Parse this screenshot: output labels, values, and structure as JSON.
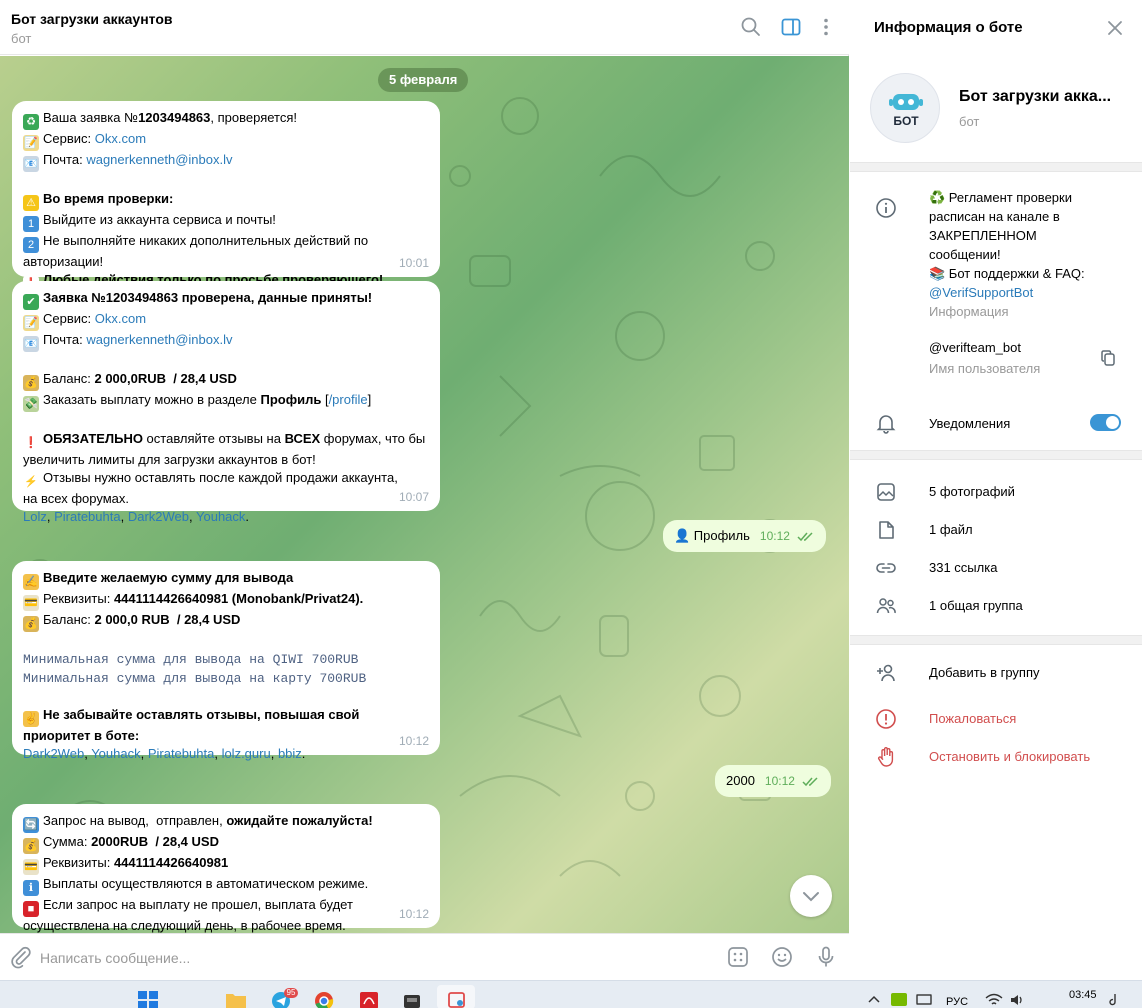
{
  "chat_header": {
    "title": "Бот загрузки аккаунтов",
    "subtitle": "бот"
  },
  "date_separator": "5 февраля",
  "messages": [
    {
      "time": "10:01",
      "lines": [
        {
          "emoji": "♻",
          "emoji_bg": "#3aa857",
          "parts": [
            {
              "t": "Ваша заявка №"
            },
            {
              "t": "1203494863",
              "b": true
            },
            {
              "t": ", проверяется!"
            }
          ]
        },
        {
          "emoji": "📝",
          "emoji_bg": "#f0d98a",
          "parts": [
            {
              "t": "Сервис: "
            },
            {
              "t": "Okx.com",
              "link": true
            }
          ]
        },
        {
          "emoji": "📧",
          "emoji_bg": "#c9d6e3",
          "parts": [
            {
              "t": "Почта: "
            },
            {
              "t": "wagnerkenneth@inbox.lv",
              "link": true
            }
          ]
        },
        {
          "parts": []
        },
        {
          "emoji": "⚠",
          "emoji_bg": "#f5c518",
          "parts": [
            {
              "t": "Во время проверки:",
              "b": true
            }
          ]
        },
        {
          "emoji": "1",
          "emoji_bg": "#3f8fd8",
          "parts": [
            {
              "t": "Выйдите из аккаунта сервиса и почты!"
            }
          ]
        },
        {
          "emoji": "2",
          "emoji_bg": "#3f8fd8",
          "parts": [
            {
              "t": "Не выполняйте никаких дополнительных действий по"
            }
          ]
        },
        {
          "parts": [
            {
              "t": "авторизации!"
            }
          ]
        },
        {
          "emoji": "❗",
          "emoji_bg": "#ffffff",
          "emoji_color": "#d8232a",
          "parts": [
            {
              "t": "Любые действия только по просьбе проверяющего!",
              "b": true
            }
          ]
        }
      ]
    },
    {
      "time": "10:07",
      "lines": [
        {
          "emoji": "✔",
          "emoji_bg": "#3aa857",
          "parts": [
            {
              "t": "Заявка №1203494863 проверена, ",
              "b": true
            },
            {
              "t": "данные приняты!",
              "b": true
            }
          ]
        },
        {
          "emoji": "📝",
          "emoji_bg": "#f0d98a",
          "parts": [
            {
              "t": "Сервис: "
            },
            {
              "t": "Okx.com",
              "link": true
            }
          ]
        },
        {
          "emoji": "📧",
          "emoji_bg": "#c9d6e3",
          "parts": [
            {
              "t": "Почта: "
            },
            {
              "t": "wagnerkenneth@inbox.lv",
              "link": true
            }
          ]
        },
        {
          "parts": []
        },
        {
          "emoji": "💰",
          "emoji_bg": "#d9b45a",
          "parts": [
            {
              "t": "Баланс: "
            },
            {
              "t": "2 000,0RUB  / 28,4 USD",
              "b": true
            }
          ]
        },
        {
          "emoji": "💸",
          "emoji_bg": "#b9d39a",
          "parts": [
            {
              "t": "Заказать выплату можно в разделе "
            },
            {
              "t": "Профиль",
              "b": true
            },
            {
              "t": " ["
            },
            {
              "t": "/profile",
              "link": true
            },
            {
              "t": "]"
            }
          ]
        },
        {
          "parts": []
        },
        {
          "emoji": "❗",
          "emoji_bg": "#ffffff",
          "emoji_color": "#d8232a",
          "parts": [
            {
              "t": "ОБЯЗАТЕЛЬНО",
              "b": true
            },
            {
              "t": " оставляйте отзывы на "
            },
            {
              "t": "ВСЕХ",
              "b": true
            },
            {
              "t": " форумах, что бы"
            }
          ]
        },
        {
          "parts": [
            {
              "t": "увеличить лимиты для загрузки аккаунтов в бот!"
            }
          ]
        },
        {
          "emoji": "⚡",
          "emoji_bg": "#ffffff",
          "emoji_color": "#f2b01e",
          "parts": [
            {
              "t": "Отзывы нужно оставлять после каждой продажи аккаунта,"
            }
          ]
        },
        {
          "parts": [
            {
              "t": "на всех форумах."
            }
          ]
        },
        {
          "parts": [
            {
              "t": "Lolz",
              "link": true
            },
            {
              "t": ", "
            },
            {
              "t": "Piratebuhta",
              "link": true
            },
            {
              "t": ", "
            },
            {
              "t": "Dark2Web",
              "link": true
            },
            {
              "t": ", "
            },
            {
              "t": "Youhack",
              "link": true
            },
            {
              "t": "."
            }
          ]
        }
      ]
    },
    {
      "time": "10:12",
      "lines": [
        {
          "emoji": "✍",
          "emoji_bg": "#f3c14b",
          "parts": [
            {
              "t": "Введите желаемую сумму для вывода",
              "b": true
            }
          ]
        },
        {
          "emoji": "💳",
          "emoji_bg": "#e9e2c8",
          "parts": [
            {
              "t": "Реквизиты: "
            },
            {
              "t": "4441114426640981 (Monobank/Privat24).",
              "b": true
            }
          ]
        },
        {
          "emoji": "💰",
          "emoji_bg": "#d9b45a",
          "parts": [
            {
              "t": "Баланс: "
            },
            {
              "t": "2 000,0 RUB  / 28,4 USD",
              "b": true
            }
          ]
        },
        {
          "parts": []
        },
        {
          "parts": [
            {
              "t": "Минимальная сумма для вывода на QIWI 700RUB",
              "mono": true
            }
          ]
        },
        {
          "parts": [
            {
              "t": "Минимальная сумма для вывода на карту 700RUB",
              "mono": true
            }
          ]
        },
        {
          "parts": []
        },
        {
          "emoji": "✌",
          "emoji_bg": "#f3c14b",
          "parts": [
            {
              "t": "Не забывайте оставлять отзывы, повышая свой",
              "b": true
            }
          ]
        },
        {
          "parts": [
            {
              "t": "приоритет в боте:",
              "b": true
            }
          ]
        },
        {
          "parts": [
            {
              "t": "Dark2Web",
              "link": true
            },
            {
              "t": ", "
            },
            {
              "t": "Youhack",
              "link": true
            },
            {
              "t": ", "
            },
            {
              "t": "Piratebuhta",
              "link": true
            },
            {
              "t": ", "
            },
            {
              "t": "lolz.guru",
              "link": true
            },
            {
              "t": ", "
            },
            {
              "t": "bbiz",
              "link": true
            },
            {
              "t": "."
            }
          ]
        }
      ]
    },
    {
      "time": "10:12",
      "lines": [
        {
          "emoji": "🔄",
          "emoji_bg": "#3f8fd8",
          "parts": [
            {
              "t": "Запрос на вывод,  отправлен, "
            },
            {
              "t": "ожидайте пожалуйста!",
              "b": true
            }
          ]
        },
        {
          "emoji": "💰",
          "emoji_bg": "#d9b45a",
          "parts": [
            {
              "t": "Сумма: "
            },
            {
              "t": "2000RUB  / 28,4 USD",
              "b": true
            }
          ]
        },
        {
          "emoji": "💳",
          "emoji_bg": "#e9e2c8",
          "parts": [
            {
              "t": "Реквизиты: "
            },
            {
              "t": "4441114426640981",
              "b": true
            }
          ]
        },
        {
          "emoji": "ℹ",
          "emoji_bg": "#3f8fd8",
          "parts": [
            {
              "t": "Выплаты осуществляются в автоматическом режиме."
            }
          ]
        },
        {
          "emoji": "■",
          "emoji_bg": "#d8232a",
          "parts": [
            {
              "t": "Если запрос на выплату не прошел, выплата будет"
            }
          ]
        },
        {
          "parts": [
            {
              "t": "осуществлена на следующий день, в рабочее время."
            }
          ]
        }
      ]
    }
  ],
  "outgoing": [
    {
      "text": "👤 Профиль",
      "time": "10:12"
    },
    {
      "text": "2000",
      "time": "10:12"
    }
  ],
  "composer": {
    "placeholder": "Написать сообщение..."
  },
  "side_panel": {
    "title": "Информация о боте",
    "avatar_label": "БОТ",
    "bot_name": "Бот загрузки акка...",
    "bot_type": "бот",
    "about_lines": [
      "♻️ Регламент проверки",
      "расписан на канале в",
      "ЗАКРЕПЛЕННОМ",
      "сообщении!",
      "📚 Бот поддержки & FAQ:"
    ],
    "about_link": "@VerifSupportBot",
    "about_caption": "Информация",
    "username": "@verifteam_bot",
    "username_caption": "Имя пользователя",
    "notifications_label": "Уведомления",
    "notifications_on": true,
    "media": {
      "photos": "5 фотографий",
      "files": "1 файл",
      "links": "331 ссылка",
      "groups": "1 общая группа"
    },
    "actions": {
      "add_group": "Добавить в группу",
      "report": "Пожаловаться",
      "block": "Остановить и блокировать"
    }
  },
  "taskbar": {
    "lang": "РУС",
    "time": "03:45",
    "telegram_badge": "95"
  },
  "colors": {
    "link": "#2b7bb9",
    "accent": "#3a95d5",
    "danger": "#d14e4e",
    "outgoing_bubble": "#effdde"
  }
}
